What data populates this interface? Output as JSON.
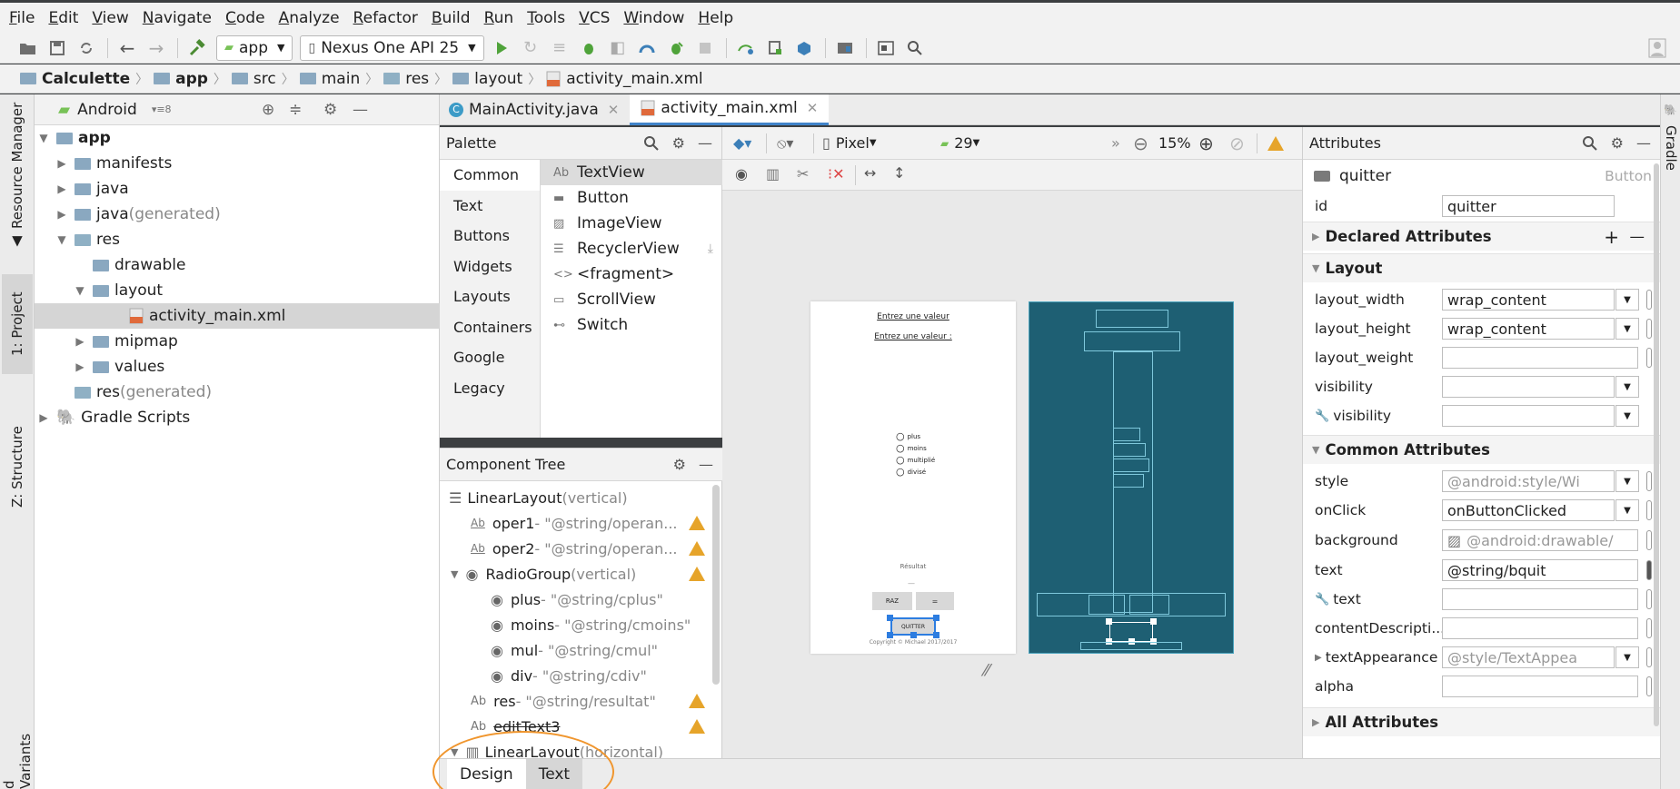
{
  "menu": [
    "File",
    "Edit",
    "View",
    "Navigate",
    "Code",
    "Analyze",
    "Refactor",
    "Build",
    "Run",
    "Tools",
    "VCS",
    "Window",
    "Help"
  ],
  "toolbar": {
    "run_config": "app",
    "device": "Nexus One API 25"
  },
  "breadcrumb": [
    "Calculette",
    "app",
    "src",
    "main",
    "res",
    "layout",
    "activity_main.xml"
  ],
  "left_tabs": {
    "resource_manager": "Resource Manager",
    "project": "1: Project",
    "structure": "Z: Structure",
    "build_variants": "d Variants"
  },
  "right_tabs": {
    "gradle": "Gradle"
  },
  "project": {
    "view_mode": "Android",
    "tree": [
      {
        "label": "app",
        "suffix": ""
      },
      {
        "label": "manifests",
        "suffix": ""
      },
      {
        "label": "java",
        "suffix": ""
      },
      {
        "label": "java",
        "suffix": " (generated)"
      },
      {
        "label": "res",
        "suffix": ""
      },
      {
        "label": "drawable",
        "suffix": ""
      },
      {
        "label": "layout",
        "suffix": ""
      },
      {
        "label": "activity_main.xml",
        "suffix": ""
      },
      {
        "label": "mipmap",
        "suffix": ""
      },
      {
        "label": "values",
        "suffix": ""
      },
      {
        "label": "res",
        "suffix": " (generated)"
      },
      {
        "label": "Gradle Scripts",
        "suffix": ""
      }
    ]
  },
  "editor_tabs": [
    "MainActivity.java",
    "activity_main.xml"
  ],
  "palette": {
    "title": "Palette",
    "categories": [
      "Common",
      "Text",
      "Buttons",
      "Widgets",
      "Layouts",
      "Containers",
      "Google",
      "Legacy"
    ],
    "items": [
      {
        "icon": "Ab",
        "label": "TextView"
      },
      {
        "icon": "▬",
        "label": "Button"
      },
      {
        "icon": "▨",
        "label": "ImageView"
      },
      {
        "icon": "☰",
        "label": "RecyclerView"
      },
      {
        "icon": "<>",
        "label": "<fragment>"
      },
      {
        "icon": "▭",
        "label": "ScrollView"
      },
      {
        "icon": "⊷",
        "label": "Switch"
      }
    ]
  },
  "component_tree": {
    "title": "Component Tree",
    "rows": [
      {
        "name": "LinearLayout",
        "detail": "(vertical)"
      },
      {
        "name": "oper1",
        "detail": "- \"@string/operan..."
      },
      {
        "name": "oper2",
        "detail": "- \"@string/operan..."
      },
      {
        "name": "RadioGroup",
        "detail": "(vertical)"
      },
      {
        "name": "plus",
        "detail": "- \"@string/cplus\""
      },
      {
        "name": "moins",
        "detail": "- \"@string/cmoins\""
      },
      {
        "name": "mul",
        "detail": "- \"@string/cmul\""
      },
      {
        "name": "div",
        "detail": "- \"@string/cdiv\""
      },
      {
        "name": "res",
        "detail": "- \"@string/resultat\""
      },
      {
        "name": "editText3",
        "detail": ""
      },
      {
        "name": "LinearLayout",
        "detail": "(horizontal)"
      }
    ]
  },
  "design_toolbar": {
    "device": "Pixel",
    "api": "29",
    "zoom": "15%"
  },
  "preview": {
    "label1": "Entrez une valeur",
    "label2": "Entrez une valeur :",
    "radios": [
      "plus",
      "moins",
      "multiplié",
      "divisé"
    ],
    "result": "Résultat",
    "btn_raz": "RAZ",
    "btn_eq": "=",
    "btn_quit": "QUITTER",
    "copyright": "Copyright © Michael 2017/2017"
  },
  "bottom_tabs": [
    "Design",
    "Text"
  ],
  "attributes": {
    "title": "Attributes",
    "component": "quitter",
    "component_type": "Button",
    "id_label": "id",
    "id_value": "quitter",
    "sections": {
      "declared": "Declared Attributes",
      "layout": "Layout",
      "common": "Common Attributes",
      "all": "All Attributes"
    },
    "layout_rows": [
      {
        "label": "layout_width",
        "value": "wrap_content",
        "hint": false,
        "dropdown": true
      },
      {
        "label": "layout_height",
        "value": "wrap_content",
        "hint": false,
        "dropdown": true
      },
      {
        "label": "layout_weight",
        "value": "",
        "hint": false,
        "dropdown": false
      },
      {
        "label": "visibility",
        "value": "",
        "hint": false,
        "dropdown": true
      },
      {
        "label": "visibility",
        "value": "",
        "hint": false,
        "dropdown": true
      }
    ],
    "common_rows": [
      {
        "label": "style",
        "value": "@android:style/Wi",
        "hint": true,
        "dropdown": true
      },
      {
        "label": "onClick",
        "value": "onButtonClicked",
        "hint": false,
        "dropdown": true
      },
      {
        "label": "background",
        "value": "@android:drawable/",
        "hint": true,
        "dropdown": false
      },
      {
        "label": "text",
        "value": "@string/bquit",
        "hint": false,
        "dropdown": false
      },
      {
        "label": "text",
        "value": "",
        "hint": false,
        "dropdown": false
      },
      {
        "label": "contentDescripti...",
        "value": "",
        "hint": false,
        "dropdown": false
      },
      {
        "label": "textAppearance",
        "value": "@style/TextAppea",
        "hint": true,
        "dropdown": true
      },
      {
        "label": "alpha",
        "value": "",
        "hint": false,
        "dropdown": false
      }
    ]
  },
  "colors": {
    "accent": "#4083c9",
    "warning": "#e6a42a",
    "blueprint": "#1e5f73",
    "highlight_ring": "#f0962e",
    "android_green": "#78c257"
  }
}
